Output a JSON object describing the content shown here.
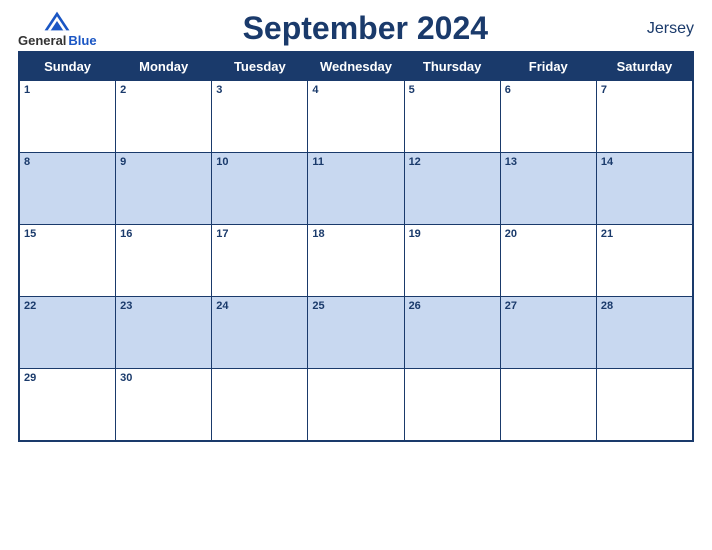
{
  "header": {
    "logo": {
      "general": "General",
      "blue": "Blue",
      "icon": "▲"
    },
    "title": "September 2024",
    "region": "Jersey"
  },
  "calendar": {
    "days_of_week": [
      "Sunday",
      "Monday",
      "Tuesday",
      "Wednesday",
      "Thursday",
      "Friday",
      "Saturday"
    ],
    "weeks": [
      {
        "colored": false,
        "days": [
          1,
          2,
          3,
          4,
          5,
          6,
          7
        ]
      },
      {
        "colored": true,
        "days": [
          8,
          9,
          10,
          11,
          12,
          13,
          14
        ]
      },
      {
        "colored": false,
        "days": [
          15,
          16,
          17,
          18,
          19,
          20,
          21
        ]
      },
      {
        "colored": true,
        "days": [
          22,
          23,
          24,
          25,
          26,
          27,
          28
        ]
      },
      {
        "colored": false,
        "days": [
          29,
          30,
          null,
          null,
          null,
          null,
          null
        ]
      }
    ]
  }
}
